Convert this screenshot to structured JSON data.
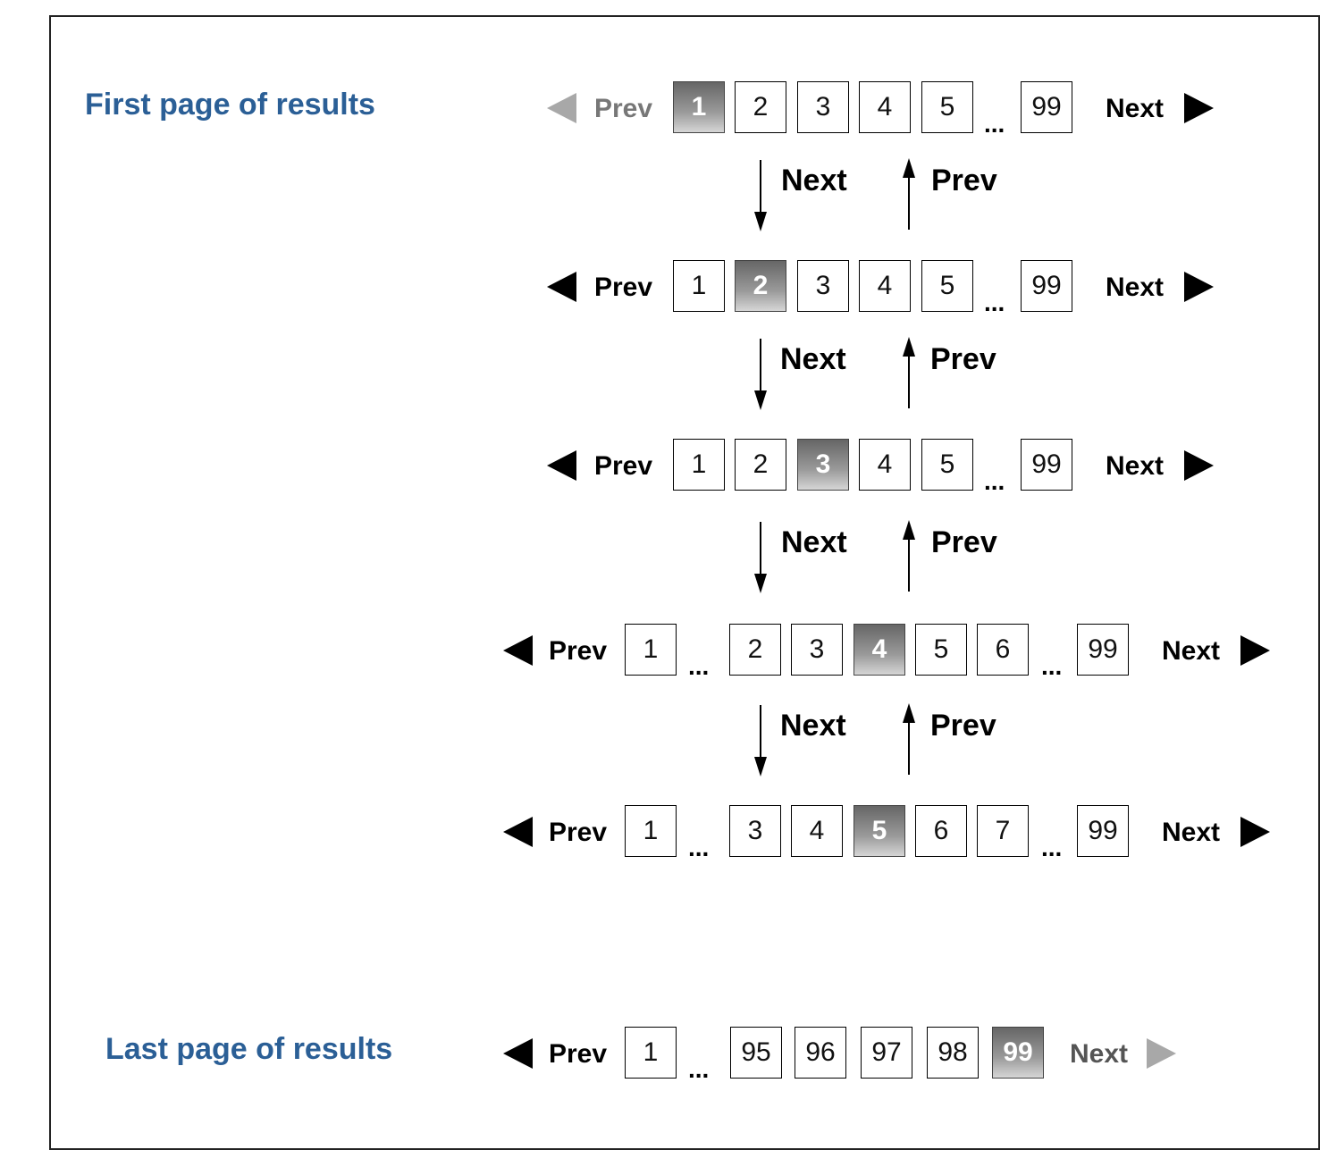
{
  "sections": {
    "first_title": "First page of results",
    "last_title": "Last page of results"
  },
  "labels": {
    "prev": "Prev",
    "next": "Next",
    "ellipsis": "..."
  },
  "pagers": [
    {
      "id": "page1",
      "prev_disabled": true,
      "next_disabled": false,
      "pages": [
        "1",
        "2",
        "3",
        "4",
        "5",
        "...",
        "99"
      ],
      "current": "1"
    },
    {
      "id": "page2",
      "prev_disabled": false,
      "next_disabled": false,
      "pages": [
        "1",
        "2",
        "3",
        "4",
        "5",
        "...",
        "99"
      ],
      "current": "2"
    },
    {
      "id": "page3",
      "prev_disabled": false,
      "next_disabled": false,
      "pages": [
        "1",
        "2",
        "3",
        "4",
        "5",
        "...",
        "99"
      ],
      "current": "3"
    },
    {
      "id": "page4",
      "prev_disabled": false,
      "next_disabled": false,
      "pages": [
        "1",
        "...",
        "2",
        "3",
        "4",
        "5",
        "6",
        "...",
        "99"
      ],
      "current": "4"
    },
    {
      "id": "page5",
      "prev_disabled": false,
      "next_disabled": false,
      "pages": [
        "1",
        "...",
        "3",
        "4",
        "5",
        "6",
        "7",
        "...",
        "99"
      ],
      "current": "5"
    },
    {
      "id": "page99",
      "prev_disabled": false,
      "next_disabled": true,
      "pages": [
        "1",
        "...",
        "95",
        "96",
        "97",
        "98",
        "99"
      ],
      "current": "99"
    }
  ],
  "transitions": [
    {
      "down": "Next",
      "up": "Prev"
    },
    {
      "down": "Next",
      "up": "Prev"
    },
    {
      "down": "Next",
      "up": "Prev"
    },
    {
      "down": "Next",
      "up": "Prev"
    }
  ]
}
